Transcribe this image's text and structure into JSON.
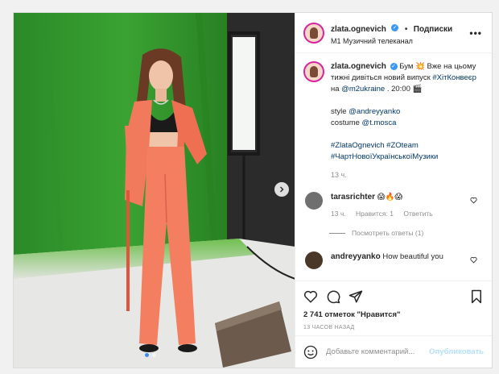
{
  "post": {
    "username": "zlata.ognevich",
    "follow_label": "Подписки",
    "location": "M1 Музичний телеканал",
    "caption_line1": "Бум 💥 Вже на цьому тижні дивіться новий випуск",
    "caption_tag1": "#ХітКонвеєр",
    "caption_on": "на",
    "caption_mention1": "@m2ukraine",
    "caption_time": ". 20:00 🎬",
    "style_label": "style",
    "style_mention": "@andreyyanko",
    "costume_label": "costume",
    "costume_mention": "@t.mosca",
    "tags_line1": "#ZlataOgnevich #ZOteam",
    "tags_line2": "#ЧартНовоїУкраїнськоїМузики",
    "caption_age": "13 ч."
  },
  "comments": [
    {
      "username": "tarasrichter",
      "text": "😱🔥😱",
      "age": "13 ч.",
      "likes_text": "Нравится: 1",
      "reply_label": "Ответить",
      "view_replies": "Посмотреть ответы (1)"
    },
    {
      "username": "andreyyanko",
      "text": "How beautiful you"
    }
  ],
  "footer": {
    "likes": "2 741 отметок \"Нравится\"",
    "posted_ago": "13 ЧАСОВ НАЗАД",
    "comment_placeholder": "Добавьте комментарий...",
    "publish_label": "Опубликовать"
  },
  "colors": {
    "accent_blue": "#3897f0",
    "link_blue": "#00376b",
    "muted": "#8e8e8e",
    "green_screen": "#2f8a2a",
    "outfit_coral": "#f27a5c"
  },
  "icons": [
    "heart-icon",
    "comment-icon",
    "share-icon",
    "bookmark-icon",
    "emoji-icon",
    "more-icon",
    "chevron-right-icon",
    "verified-icon"
  ]
}
